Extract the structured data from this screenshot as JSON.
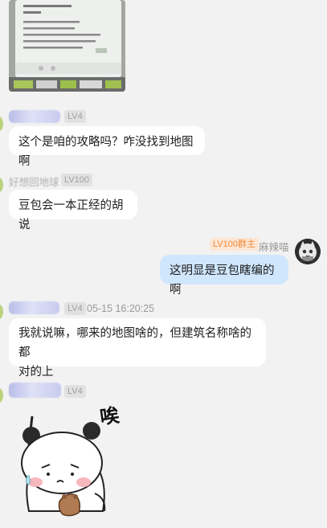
{
  "messages": [
    {
      "level": "LV4",
      "text": "这个是咱的攻略吗？咋没找到地图啊"
    },
    {
      "name": "好想回地球",
      "level": "LV100",
      "text": "豆包会一本正经的胡说"
    },
    {
      "name": "麻辣喵",
      "badge": "LV100群主",
      "text": "这明显是豆包瞎编的啊"
    },
    {
      "level": "LV4",
      "time": "05-15 16:20:25",
      "text_line1": "我就说嘛，哪来的地图啥的，但建筑名称啥的都",
      "text_line2": "对的上"
    },
    {
      "level": "LV4",
      "sticker_text": "唉"
    }
  ],
  "colors": {
    "background": "#f2f2f2",
    "bubble_other": "#ffffff",
    "bubble_self": "#cfe6fd",
    "owner_badge": "#f08a3a"
  }
}
